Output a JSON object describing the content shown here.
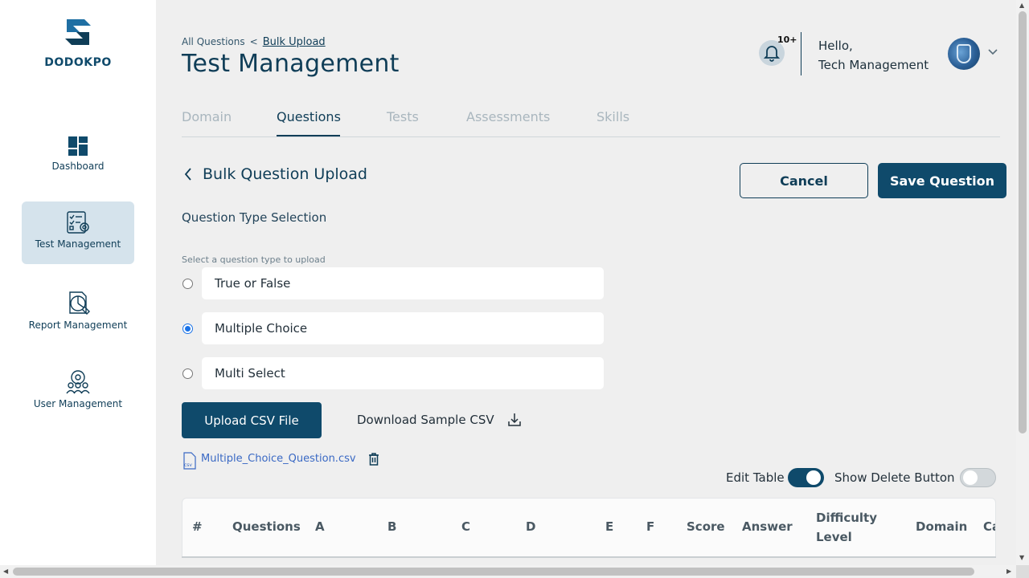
{
  "brand": {
    "name": "DODOKPO"
  },
  "sidebar": {
    "items": [
      {
        "label": "Dashboard",
        "icon": "dashboard-icon",
        "active": false
      },
      {
        "label": "Test Management",
        "icon": "test-management-icon",
        "active": true
      },
      {
        "label": "Report Management",
        "icon": "report-management-icon",
        "active": false
      },
      {
        "label": "User Management",
        "icon": "user-management-icon",
        "active": false
      }
    ]
  },
  "header": {
    "breadcrumb": {
      "parent": "All Questions",
      "separator": "<",
      "current": "Bulk Upload"
    },
    "title": "Test Management",
    "notifications_badge": "10+",
    "greeting_line1": "Hello,",
    "greeting_line2": "Tech Management"
  },
  "tabs": [
    {
      "label": "Domain",
      "active": false
    },
    {
      "label": "Questions",
      "active": true
    },
    {
      "label": "Tests",
      "active": false
    },
    {
      "label": "Assessments",
      "active": false
    },
    {
      "label": "Skills",
      "active": false
    }
  ],
  "section": {
    "title": "Bulk Question Upload",
    "cancel_label": "Cancel",
    "save_label": "Save Question"
  },
  "question_type": {
    "heading": "Question Type Selection",
    "hint": "Select a question type to upload",
    "options": [
      {
        "label": "True or False",
        "selected": false
      },
      {
        "label": "Multiple Choice",
        "selected": true
      },
      {
        "label": "Multi Select",
        "selected": false
      }
    ]
  },
  "upload": {
    "upload_label": "Upload CSV File",
    "download_label": "Download Sample CSV",
    "file_name": "Multiple_Choice_Question.csv"
  },
  "table_controls": {
    "edit_table_label": "Edit Table",
    "edit_table_on": true,
    "show_delete_label": "Show Delete Button",
    "show_delete_on": false
  },
  "table": {
    "columns": [
      "#",
      "Questions",
      "A",
      "B",
      "C",
      "D",
      "E",
      "F",
      "Score",
      "Answer",
      "Difficulty",
      "Level",
      "Domain",
      "Ca"
    ]
  },
  "colors": {
    "primary": "#0f4a6b",
    "sidebar_active": "#d5e3ec",
    "background": "#efefef",
    "link": "#3a69c4"
  }
}
